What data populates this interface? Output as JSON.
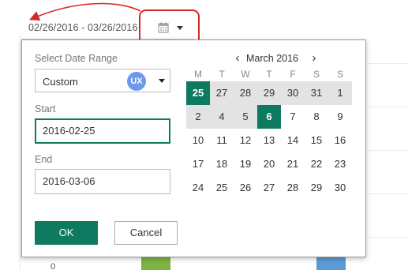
{
  "trigger": {
    "range_text": "02/26/2016 - 03/26/2016",
    "icon": "calendar-icon"
  },
  "popup": {
    "range_label": "Select Date Range",
    "range_value": "Custom",
    "badge": "UX",
    "start_label": "Start",
    "start_value": "2016-02-25",
    "end_label": "End",
    "end_value": "2016-03-06",
    "ok_label": "OK",
    "cancel_label": "Cancel"
  },
  "calendar": {
    "title": "March 2016",
    "prev": "‹",
    "next": "›",
    "weekdays": [
      "M",
      "T",
      "W",
      "T",
      "F",
      "S",
      "S"
    ],
    "weeks": [
      [
        {
          "d": "25",
          "s": "selected"
        },
        {
          "d": "27",
          "s": "range"
        },
        {
          "d": "28",
          "s": "range"
        },
        {
          "d": "29",
          "s": "range"
        },
        {
          "d": "30",
          "s": "range"
        },
        {
          "d": "31",
          "s": "range"
        },
        {
          "d": "1",
          "s": "range"
        }
      ],
      [
        {
          "d": "2",
          "s": "range"
        },
        {
          "d": "4",
          "s": "range"
        },
        {
          "d": "5",
          "s": "range"
        },
        {
          "d": "6",
          "s": "selected"
        },
        {
          "d": "7",
          "s": ""
        },
        {
          "d": "8",
          "s": ""
        },
        {
          "d": "9",
          "s": ""
        }
      ],
      [
        {
          "d": "10",
          "s": ""
        },
        {
          "d": "11",
          "s": ""
        },
        {
          "d": "12",
          "s": ""
        },
        {
          "d": "13",
          "s": ""
        },
        {
          "d": "14",
          "s": ""
        },
        {
          "d": "15",
          "s": ""
        },
        {
          "d": "16",
          "s": ""
        }
      ],
      [
        {
          "d": "17",
          "s": ""
        },
        {
          "d": "18",
          "s": ""
        },
        {
          "d": "19",
          "s": ""
        },
        {
          "d": "20",
          "s": ""
        },
        {
          "d": "21",
          "s": ""
        },
        {
          "d": "22",
          "s": ""
        },
        {
          "d": "23",
          "s": ""
        }
      ],
      [
        {
          "d": "24",
          "s": ""
        },
        {
          "d": "25",
          "s": ""
        },
        {
          "d": "26",
          "s": ""
        },
        {
          "d": "27",
          "s": ""
        },
        {
          "d": "28",
          "s": ""
        },
        {
          "d": "29",
          "s": ""
        },
        {
          "d": "30",
          "s": ""
        }
      ]
    ]
  },
  "background": {
    "axis_zero": "0"
  },
  "colors": {
    "accent": "#0e7a5f",
    "range_fill": "#e3e3e3",
    "annotation": "#d62728",
    "badge": "#6b9be8"
  }
}
